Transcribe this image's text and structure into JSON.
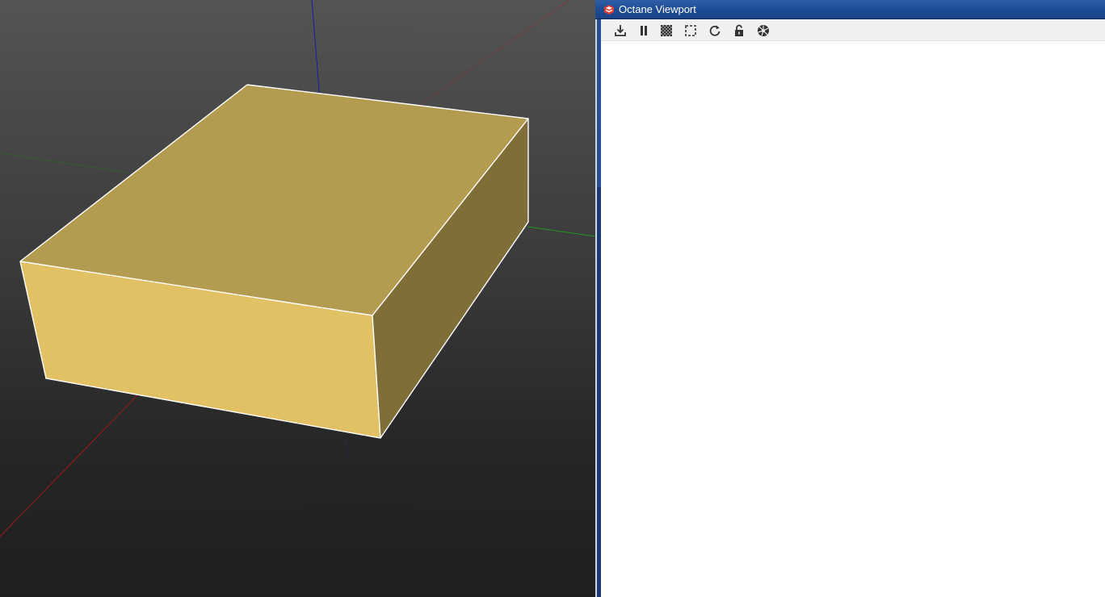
{
  "window": {
    "title": "Octane Viewport",
    "app_icon": "sketchup-logo-icon"
  },
  "toolbar": {
    "buttons": [
      {
        "icon": "download-icon",
        "label": ""
      },
      {
        "icon": "pause-icon",
        "label": ""
      },
      {
        "icon": "checker-icon",
        "label": ""
      },
      {
        "icon": "region-select-icon",
        "label": ""
      },
      {
        "icon": "refresh-icon",
        "label": ""
      },
      {
        "icon": "unlock-icon",
        "label": ""
      },
      {
        "icon": "aperture-icon",
        "label": ""
      }
    ]
  },
  "scene": {
    "object": "box",
    "colors": {
      "top": "#b39c50",
      "front": "#e2c064",
      "side": "#7f6e37",
      "edge": "#ffffff",
      "axis_red": "#a01818",
      "axis_green": "#1c9a1c",
      "axis_blue": "#1a1ab0"
    }
  },
  "colors": {
    "titlebar": "#1d4b93",
    "toolbar": "#f0f0f0",
    "render_background": "#ffffff"
  }
}
